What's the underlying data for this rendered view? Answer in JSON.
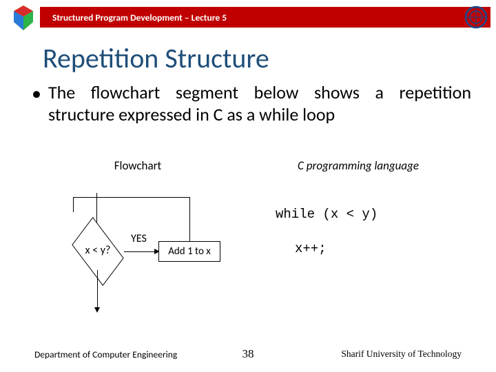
{
  "header": {
    "course": "Structured Program Development – Lecture 5"
  },
  "title": "Repetition Structure",
  "bullet": "The flowchart segment below shows a repetition structure expressed in C as a while loop",
  "columns": {
    "left": "Flowchart",
    "right": "C  programming language"
  },
  "flowchart": {
    "decision": "x < y?",
    "yes": "YES",
    "process": "Add 1 to x"
  },
  "code": {
    "line1": "while (x < y)",
    "line2": "x++;"
  },
  "footer": {
    "left": "Department of Computer Engineering",
    "center": "38",
    "right": "Sharif University of Technology"
  }
}
